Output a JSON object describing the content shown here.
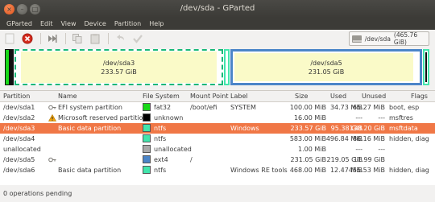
{
  "window": {
    "title": "/dev/sda - GParted"
  },
  "menu": [
    "GParted",
    "Edit",
    "View",
    "Device",
    "Partition",
    "Help"
  ],
  "toolbar": {
    "icons": [
      "new-icon",
      "delete-icon",
      "resize-icon",
      "copy-icon",
      "paste-icon",
      "undo-icon",
      "apply-icon"
    ],
    "device": "/dev/sda",
    "device_size": "(465.76 GiB)"
  },
  "diskmap": {
    "sda3": {
      "name": "/dev/sda3",
      "size": "233.57 GiB"
    },
    "sda5": {
      "name": "/dev/sda5",
      "size": "231.05 GiB"
    }
  },
  "columns": {
    "partition": "Partition",
    "name": "Name",
    "fs": "File System",
    "mount": "Mount Point",
    "label": "Label",
    "size": "Size",
    "used": "Used",
    "unused": "Unused",
    "flags": "Flags"
  },
  "rows": [
    {
      "partition": "/dev/sda1",
      "icon": "key-icon",
      "name": "EFI system partition",
      "fs": "fat32",
      "fs_color": "#18d918",
      "mount": "/boot/efi",
      "label": "SYSTEM",
      "size": "100.00 MiB",
      "used": "34.73 MiB",
      "unused": "65.27 MiB",
      "flags": "boot, esp"
    },
    {
      "partition": "/dev/sda2",
      "icon": "warning-icon",
      "name": "Microsoft reserved partition",
      "fs": "unknown",
      "fs_color": "#000000",
      "mount": "",
      "label": "",
      "size": "16.00 MiB",
      "used": "---",
      "unused": "---",
      "flags": "msftres"
    },
    {
      "partition": "/dev/sda3",
      "icon": "",
      "name": "Basic data partition",
      "fs": "ntfs",
      "fs_color": "#42e5ac",
      "mount": "",
      "label": "Windows",
      "size": "233.57 GiB",
      "used": "95.38 GiB",
      "unused": "138.20 GiB",
      "flags": "msftdata"
    },
    {
      "partition": "/dev/sda4",
      "icon": "",
      "name": "",
      "fs": "ntfs",
      "fs_color": "#42e5ac",
      "mount": "",
      "label": "",
      "size": "583.00 MiB",
      "used": "496.84 MiB",
      "unused": "86.16 MiB",
      "flags": "hidden, diag"
    },
    {
      "partition": "unallocated",
      "icon": "",
      "name": "",
      "fs": "unallocated",
      "fs_color": "#a9a9a9",
      "mount": "",
      "label": "",
      "size": "1.00 MiB",
      "used": "---",
      "unused": "---",
      "flags": ""
    },
    {
      "partition": "/dev/sda5",
      "icon": "key-icon",
      "name": "",
      "fs": "ext4",
      "fs_color": "#4b85c8",
      "mount": "/",
      "label": "",
      "size": "231.05 GiB",
      "used": "219.05 GiB",
      "unused": "11.99 GiB",
      "flags": ""
    },
    {
      "partition": "/dev/sda6",
      "icon": "",
      "name": "Basic data partition",
      "fs": "ntfs",
      "fs_color": "#42e5ac",
      "mount": "",
      "label": "Windows RE tools",
      "size": "468.00 MiB",
      "used": "12.47 MiB",
      "unused": "455.53 MiB",
      "flags": "hidden, diag"
    }
  ],
  "status": "0 operations pending"
}
